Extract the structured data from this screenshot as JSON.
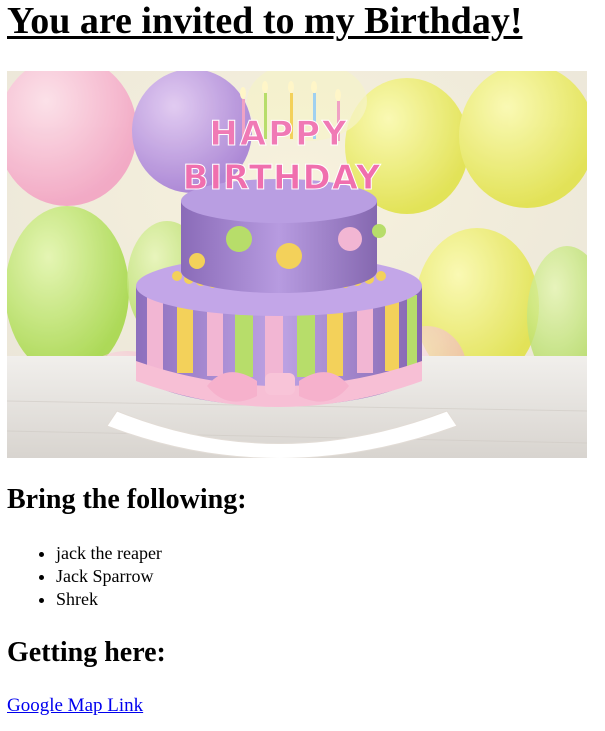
{
  "page": {
    "title": "You are invited to my Birthday!"
  },
  "hero_image": {
    "description_name": "birthday-cake-photo",
    "topper_text_line1": "HAPPY",
    "topper_text_line2": "BIRTHDAY"
  },
  "bring_section": {
    "heading": "Bring the following:",
    "items": [
      "jack the reaper",
      "Jack Sparrow",
      "Shrek"
    ]
  },
  "directions_section": {
    "heading": "Getting here:",
    "link_label": "Google Map Link"
  },
  "colors": {
    "link": "#0000ee",
    "text": "#000000",
    "background": "#ffffff"
  }
}
